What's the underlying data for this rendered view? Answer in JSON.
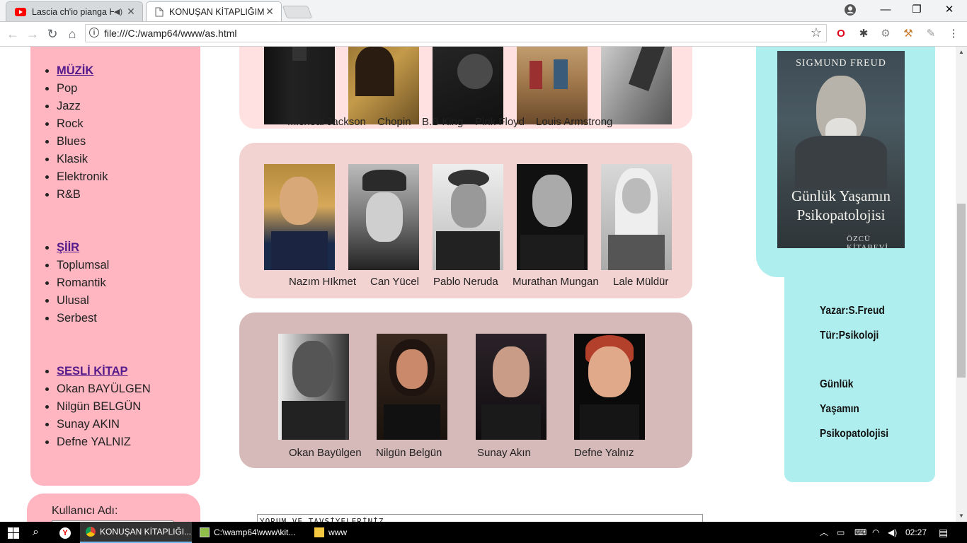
{
  "browser": {
    "tabs": [
      {
        "title": "Lascia ch'io pianga HW"
      },
      {
        "title": "KONUŞAN KİTAPLIĞIM"
      }
    ],
    "url": "file:///C:/wamp64/www/as.html"
  },
  "menu": [
    {
      "heading": "MÜZİK",
      "items": [
        "Pop",
        "Jazz",
        "Rock",
        "Blues",
        "Klasik",
        "Elektronik",
        "R&B"
      ]
    },
    {
      "heading": "ŞİİR",
      "items": [
        "Toplumsal",
        "Romantik",
        "Ulusal",
        "Serbest"
      ]
    },
    {
      "heading": "SESLİ KİTAP",
      "items": [
        "Okan BAYÜLGEN",
        "Nilgün BELGÜN",
        "Sunay AKIN",
        "Defne YALNIZ"
      ]
    }
  ],
  "login": {
    "username_label": "Kullanıcı Adı:"
  },
  "music_captions": [
    "Micheal Jackson",
    "Chopin",
    "B.B King",
    "Pink Floyd",
    "Louis Armstrong"
  ],
  "poetry_captions": [
    "Nazım HIkmet",
    "Can Yücel",
    "Pablo Neruda",
    "Murathan Mungan",
    "Lale Müldür"
  ],
  "audiobook_captions": [
    "Okan Bayülgen",
    "Nilgün Belgün",
    "Sunay Akın",
    "Defne Yalnız"
  ],
  "comment_box": "YORUM VE TAVSİYELERİNİZ",
  "book": {
    "cover_author": "SIGMUND FREUD",
    "cover_title_line1": "Günlük Yaşamın",
    "cover_title_line2": "Psikopatolojisi",
    "cover_publisher": "ÖZCÜ KİTABEVİ",
    "author_line": "Yazar:S.Freud",
    "genre_line": "Tür:Psikoloji",
    "title_lines": [
      "Günlük",
      "Yaşamın",
      "Psikopatolojisi"
    ]
  },
  "taskbar": {
    "apps": [
      "KONUŞAN KİTAPLIĞI...",
      "C:\\wamp64\\www\\kit...",
      "www"
    ],
    "time": "02:27"
  }
}
